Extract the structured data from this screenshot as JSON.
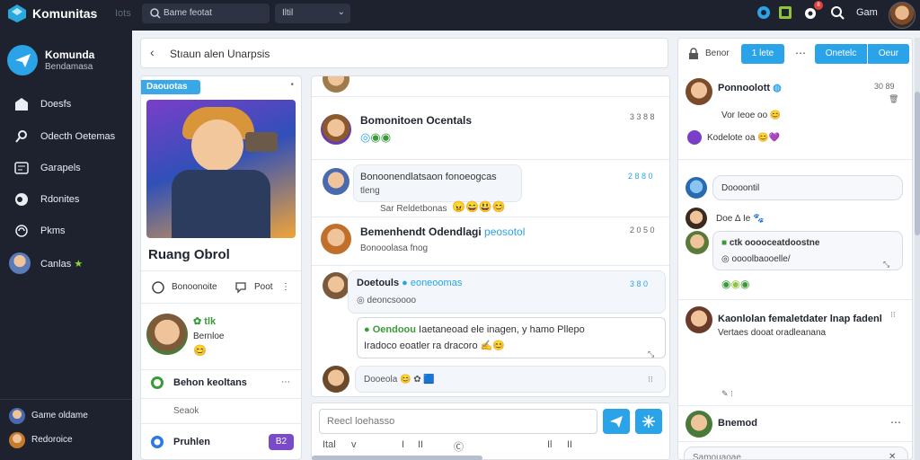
{
  "topbar": {
    "brand": "Komunitas",
    "brand_sub": "Iots",
    "search_placeholder": "Bame feotat",
    "filter_value": "Iltil",
    "notif_count": "8",
    "user_name": "Gam"
  },
  "sidebar": {
    "community_name": "Komunda",
    "community_sub": "Bendamasa",
    "items": [
      {
        "label": "Doesfs",
        "icon": "home-icon"
      },
      {
        "label": "Odecth Oetemas",
        "icon": "search-icon"
      },
      {
        "label": "Garapels",
        "icon": "game-icon"
      },
      {
        "label": "Rdonites",
        "icon": "compass-icon"
      },
      {
        "label": "Pkms",
        "icon": "people-icon"
      },
      {
        "label": "Canlas",
        "icon": "avatar-icon"
      }
    ],
    "users": [
      {
        "name": "Game oldame"
      },
      {
        "name": "Redoroice"
      }
    ]
  },
  "breadcrumb": {
    "title": "Stıaun alen Unarpsis"
  },
  "group": {
    "tag": "Daouotas",
    "title": "Ruang Obrol",
    "meta1": "Bonoonoite",
    "meta2": "Poot",
    "member_tag": "tlk",
    "member_name": "Bernloe",
    "row1": "Behon keoltans",
    "row1_sub": "Seaok",
    "row2": "Pruhlen",
    "row2_badge": "B2"
  },
  "feed": {
    "posts": [
      {
        "title": "Bomonitoen Ocentals",
        "time": "3 3 8 8"
      },
      {
        "text": "Bonoonendlatsaon fonoeogcas",
        "sub": "tleng",
        "sub2": "Sar Reldetbonas",
        "time": "2 8 8 0"
      },
      {
        "title": "Bemenhendt Odendlagi",
        "tag": "peosotol",
        "sub": "Bonooolasa fnog",
        "time": "2 0 5 0"
      },
      {
        "name": "Doetouls",
        "tag": "eoneoomas",
        "sub": "deoncsoooo",
        "time": "3 8 0",
        "quote_tag": "Oendoou",
        "quote": "Iaetaneoad ele inagen, y hamo Pllepo",
        "quote2": "Iradoco eoatler ra dracoro"
      },
      {
        "text": "Dooeola"
      }
    ],
    "composer_placeholder": "Reecl loehasso",
    "composer_tools": [
      "Ital",
      "v",
      "I",
      "II",
      "Ⓒ",
      "Il",
      "II"
    ]
  },
  "right": {
    "header_label": "Benor",
    "btn1": "1 lete",
    "btn2": "Onetelc",
    "btn3": "Oeur",
    "threads": [
      {
        "title": "Ponnoolott",
        "time": "30 89",
        "text": "Vor Ieoe oo"
      },
      {
        "text": "Kodelote oa"
      },
      {
        "text": "Doooontil"
      },
      {
        "text": "Doe ∆ Ie"
      },
      {
        "title": "ctk ooooceatdoostne",
        "text": "oooolbaooelle/"
      },
      {
        "title": "Kaonlolan femaletdater lnap fadenl",
        "text": "Vertaes dooat oradleanana"
      },
      {
        "title": "Bnemod"
      },
      {
        "placeholder": "Samouaoae"
      }
    ]
  }
}
